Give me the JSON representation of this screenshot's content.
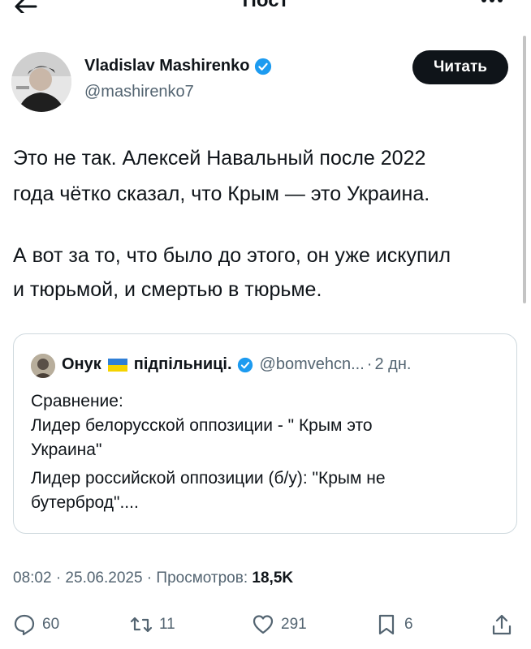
{
  "header": {
    "title": "Пост",
    "back_icon": "arrow-left-icon",
    "more_icon": "more-dots-icon"
  },
  "author": {
    "name": "Vladislav Mashirenko",
    "handle": "@mashirenko7",
    "verified": true,
    "follow_label": "Читать"
  },
  "post": {
    "lines": [
      "Это не так. Алексей Навальный после 2022",
      "года чётко сказал, что Крым — это Украина.",
      "А вот за то, что было до этого, он уже искупил",
      "и тюрьмой, и смертью в тюрьме."
    ]
  },
  "quote": {
    "name_part1": "Онук",
    "name_part2": "підпільниці.",
    "handle": "@bomvehcn...",
    "separator": "·",
    "time": "2 дн.",
    "lines": [
      "Сравнение:",
      "Лидер белорусской оппозиции - \" Крым это",
      "Украина\"",
      "Лидер российской оппозиции (б/у): \"Крым не",
      "бутерброд\"...."
    ]
  },
  "meta": {
    "time_date": "08:02 · 25.06.2025 · Просмотров:",
    "views": "18,5K"
  },
  "actions": {
    "replies": "60",
    "reposts": "11",
    "likes": "291",
    "bookmarks": "6"
  },
  "colors": {
    "text": "#0f1419",
    "muted": "#536471",
    "verified": "#1d9bf0",
    "border": "#cfd9de"
  }
}
